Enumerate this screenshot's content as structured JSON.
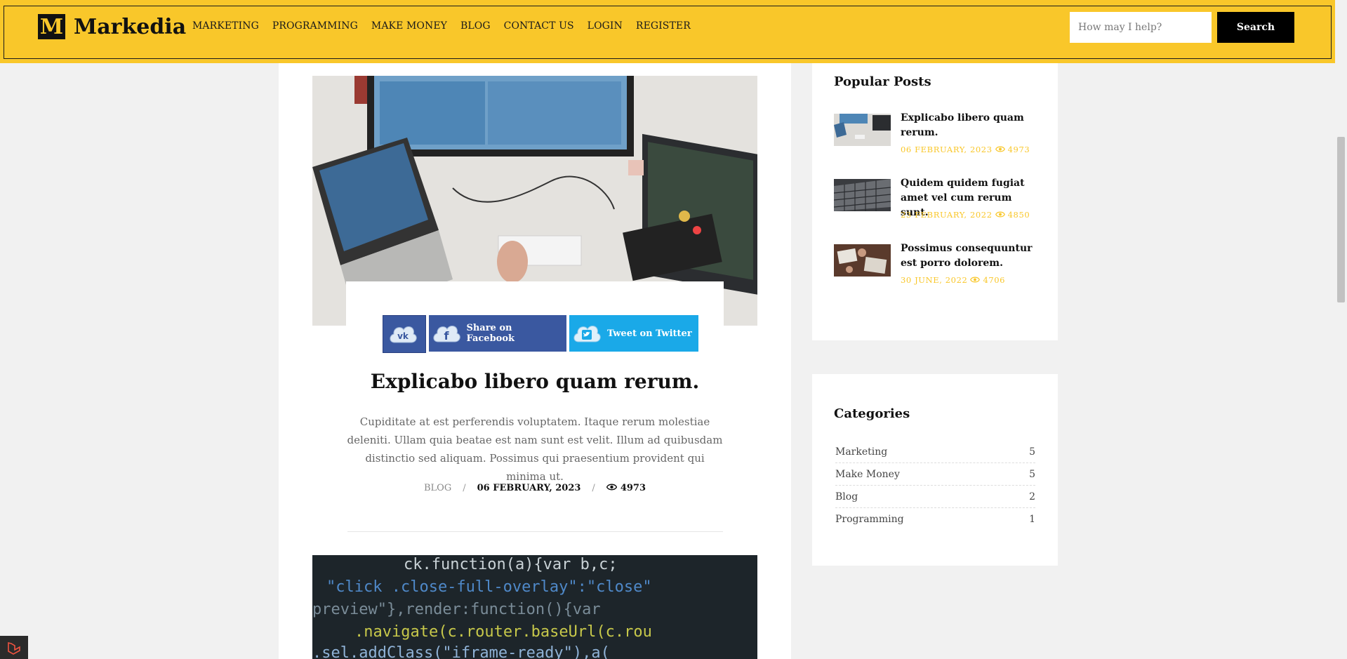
{
  "header": {
    "logo_mark": "M",
    "logo_text": "Markedia",
    "nav": [
      "MARKETING",
      "PROGRAMMING",
      "MAKE MONEY",
      "BLOG",
      "CONTACT US",
      "LOGIN",
      "REGISTER"
    ],
    "search_placeholder": "How may I help?",
    "search_button": "Search"
  },
  "post": {
    "share": {
      "facebook_label": "Share on Facebook",
      "twitter_label": "Tweet on Twitter"
    },
    "title": "Explicabo libero quam rerum.",
    "excerpt": "Cupiditate at est perferendis voluptatem. Itaque rerum molestiae deleniti. Ullam quia beatae est nam sunt est velit. Illum ad quibusdam distinctio sed aliquam. Possimus qui praesentium provident qui minima ut.",
    "category": "BLOG",
    "separator": "/",
    "date": "06 FEBRUARY, 2023",
    "views": "4973"
  },
  "sidebar": {
    "popular_heading": "Popular Posts",
    "popular": [
      {
        "title": "Explicabo libero quam rerum.",
        "date": "06 FEBRUARY, 2023",
        "views": "4973"
      },
      {
        "title": "Quidem quidem fugiat amet vel cum rerum sunt.",
        "date": "23 FEBRUARY, 2022",
        "views": "4850"
      },
      {
        "title": "Possimus consequuntur est porro dolorem.",
        "date": "30 JUNE, 2022",
        "views": "4706"
      }
    ],
    "categories_heading": "Categories",
    "categories": [
      {
        "name": "Marketing",
        "count": "5"
      },
      {
        "name": "Make Money",
        "count": "5"
      },
      {
        "name": "Blog",
        "count": "2"
      },
      {
        "name": "Programming",
        "count": "1"
      }
    ]
  },
  "colors": {
    "accent": "#f9c72a",
    "facebook": "#3a58a0",
    "twitter": "#1aa9e8"
  }
}
